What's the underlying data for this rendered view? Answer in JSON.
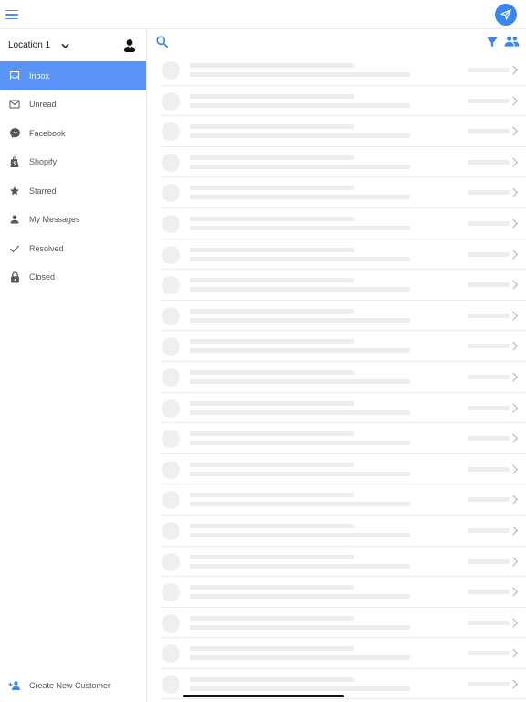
{
  "header": {
    "menu_icon": "hamburger-icon",
    "compose_icon": "send-icon",
    "accent_color": "#3a86f0"
  },
  "sidebar": {
    "location": "Location 1",
    "active_color": "#5b94f7",
    "items": [
      {
        "label": "Inbox",
        "icon": "inbox-icon",
        "active": true
      },
      {
        "label": "Unread",
        "icon": "mail-icon",
        "active": false
      },
      {
        "label": "Facebook",
        "icon": "messenger-icon",
        "active": false
      },
      {
        "label": "Shopify",
        "icon": "shopify-bag-icon",
        "active": false
      },
      {
        "label": "Starred",
        "icon": "star-icon",
        "active": false
      },
      {
        "label": "My Messages",
        "icon": "person-icon",
        "active": false
      },
      {
        "label": "Resolved",
        "icon": "checkmark-icon",
        "active": false
      },
      {
        "label": "Closed",
        "icon": "lock-icon",
        "active": false
      }
    ],
    "create_label": "Create New Customer"
  },
  "main": {
    "toolbar_icons": [
      "search-icon",
      "filter-icon",
      "people-icon"
    ],
    "loading_placeholder_rows": 21
  }
}
